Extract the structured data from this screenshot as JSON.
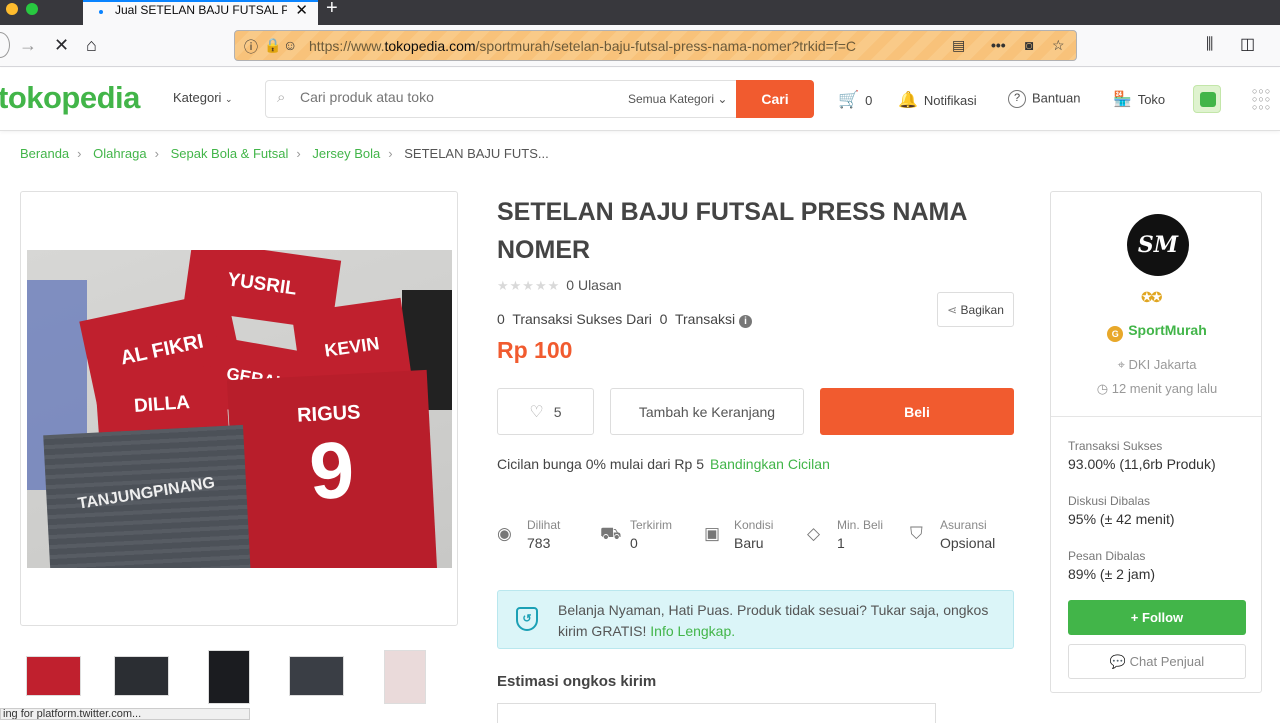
{
  "browser": {
    "tab_title": "Jual SETELAN BAJU FUTSAL PR",
    "url_prefix": "https://www.",
    "url_domain": "tokopedia.com",
    "url_path": "/sportmurah/setelan-baju-futsal-press-nama-nomer?trkid=f=C",
    "status_text": "ing for platform.twitter.com..."
  },
  "header": {
    "logo": "tokopedia",
    "kategori": "Kategori",
    "search_placeholder": "Cari produk atau toko",
    "search_category": "Semua Kategori",
    "search_button": "Cari",
    "cart_count": "0",
    "notifikasi": "Notifikasi",
    "bantuan": "Bantuan",
    "toko": "Toko"
  },
  "breadcrumb": [
    "Beranda",
    "Olahraga",
    "Sepak Bola & Futsal",
    "Jersey Bola",
    "SETELAN BAJU FUTS..."
  ],
  "product": {
    "title": "SETELAN BAJU FUTSAL PRESS NAMA NOMER",
    "reviews": "0 Ulasan",
    "trans_success": "0",
    "trans_success_label": "Transaksi Sukses Dari",
    "trans_total": "0",
    "trans_total_label": "Transaksi",
    "share": "Bagikan",
    "price": "Rp 100",
    "wishlist_count": "5",
    "add_to_cart": "Tambah ke Keranjang",
    "buy": "Beli",
    "installment_text": "Cicilan bunga 0% mulai dari Rp 5",
    "installment_link": "Bandingkan Cicilan",
    "stats": [
      {
        "label": "Dilihat",
        "value": "783",
        "icon": "eye-icon"
      },
      {
        "label": "Terkirim",
        "value": "0",
        "icon": "truck-icon"
      },
      {
        "label": "Kondisi",
        "value": "Baru",
        "icon": "box-icon"
      },
      {
        "label": "Min. Beli",
        "value": "1",
        "icon": "tag-icon"
      },
      {
        "label": "Asuransi",
        "value": "Opsional",
        "icon": "shield-check-icon"
      }
    ],
    "guarantee_text": "Belanja Nyaman, Hati Puas. Produk tidak sesuai? Tukar saja, ongkos kirim GRATIS!",
    "guarantee_link": "Info Lengkap.",
    "shipping_title": "Estimasi ongkos kirim",
    "image_names": [
      "YUSRIL",
      "AL FIKRI",
      "KEVIN",
      "GERALD",
      "DILLA",
      "RIGUS",
      "9",
      "TANJUNGPINANG"
    ]
  },
  "shop": {
    "avatar_text": "SM",
    "name": "SportMurah",
    "location": "DKI Jakarta",
    "last_online": "12 menit yang lalu",
    "stats": [
      {
        "label": "Transaksi Sukses",
        "value": "93.00% (11,6rb Produk)"
      },
      {
        "label": "Diskusi Dibalas",
        "value": "95% (± 42 menit)"
      },
      {
        "label": "Pesan Dibalas",
        "value": "89% (± 2 jam)"
      }
    ],
    "follow": "Follow",
    "chat": "Chat Penjual"
  },
  "colors": {
    "brand_green": "#42b549",
    "accent_orange": "#f15b2f"
  }
}
